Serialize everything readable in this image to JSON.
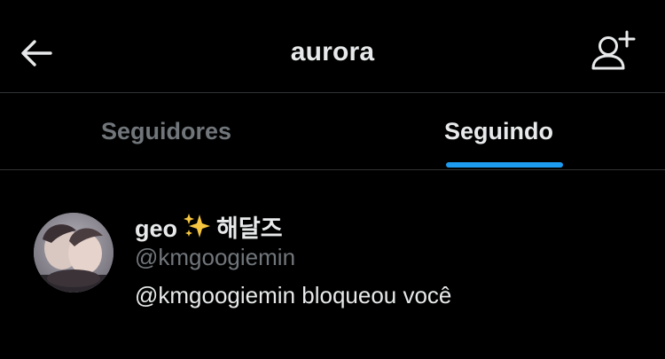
{
  "header": {
    "title": "aurora",
    "back_icon": "arrow-left-icon",
    "add_user_icon": "add-user-icon"
  },
  "tabs": [
    {
      "label": "Seguidores",
      "active": false
    },
    {
      "label": "Seguindo",
      "active": true
    }
  ],
  "accent_color": "#1d9bf0",
  "users": [
    {
      "display_name": "geo",
      "display_emoji": "sparkles-icon",
      "display_suffix": "해달즈",
      "handle": "@kmgoogiemin",
      "bio": "@kmgoogiemin bloqueou você"
    }
  ]
}
